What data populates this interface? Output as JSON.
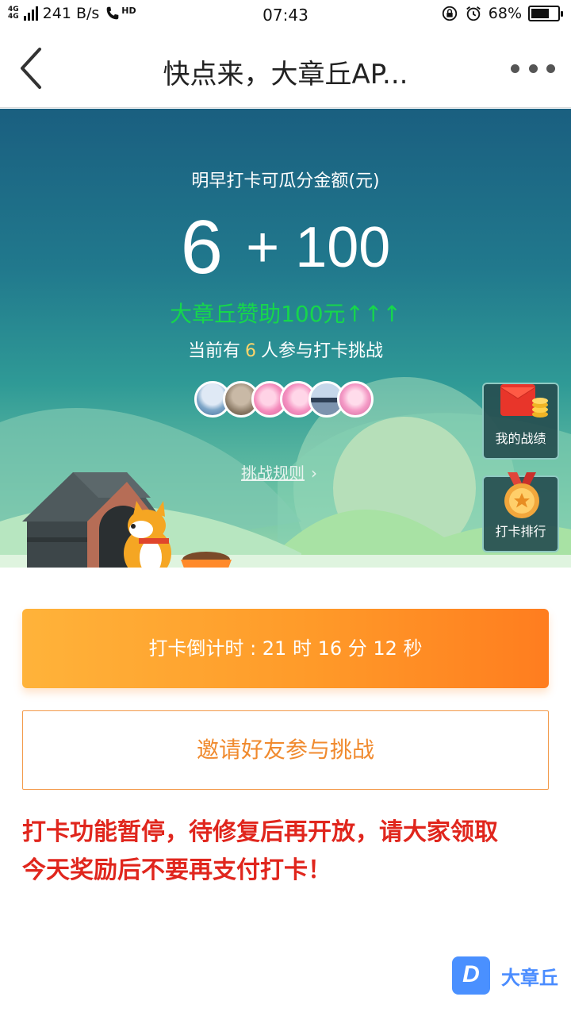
{
  "status_bar": {
    "network_top": "4G",
    "network_bottom": "4G",
    "speed": "241 B/s",
    "hd_label": "HD",
    "time": "07:43",
    "battery_percent_text": "68%",
    "battery_level": 0.68
  },
  "nav": {
    "title": "快点来，大章丘AP..."
  },
  "hero": {
    "caption": "明早打卡可瓜分金额(元)",
    "amount_main": "6",
    "amount_bonus": "+ 100",
    "sponsor_text": "大章丘赞助100元↑↑↑",
    "participants_prefix": "当前有",
    "participants_count": "6",
    "participants_suffix": "人参与打卡挑战",
    "rules_link": "挑战规则",
    "avatars_count": 6
  },
  "side_buttons": {
    "record_label": "我的战绩",
    "ranking_label": "打卡排行"
  },
  "actions": {
    "countdown_text": "打卡倒计时 : 21 时 16 分 12 秒",
    "invite_text": "邀请好友参与挑战"
  },
  "notice": {
    "line1": "打卡功能暂停，待修复后再开放，请大家领取",
    "line2": "今天奖励后不要再支付打卡！"
  },
  "watermark": {
    "text": "大章丘",
    "logo_letter": "D"
  },
  "colors": {
    "accent_orange": "#ff9a29",
    "notice_red": "#e0261d",
    "sponsor_green": "#16d64c",
    "highlight_yellow": "#ffd56a"
  }
}
